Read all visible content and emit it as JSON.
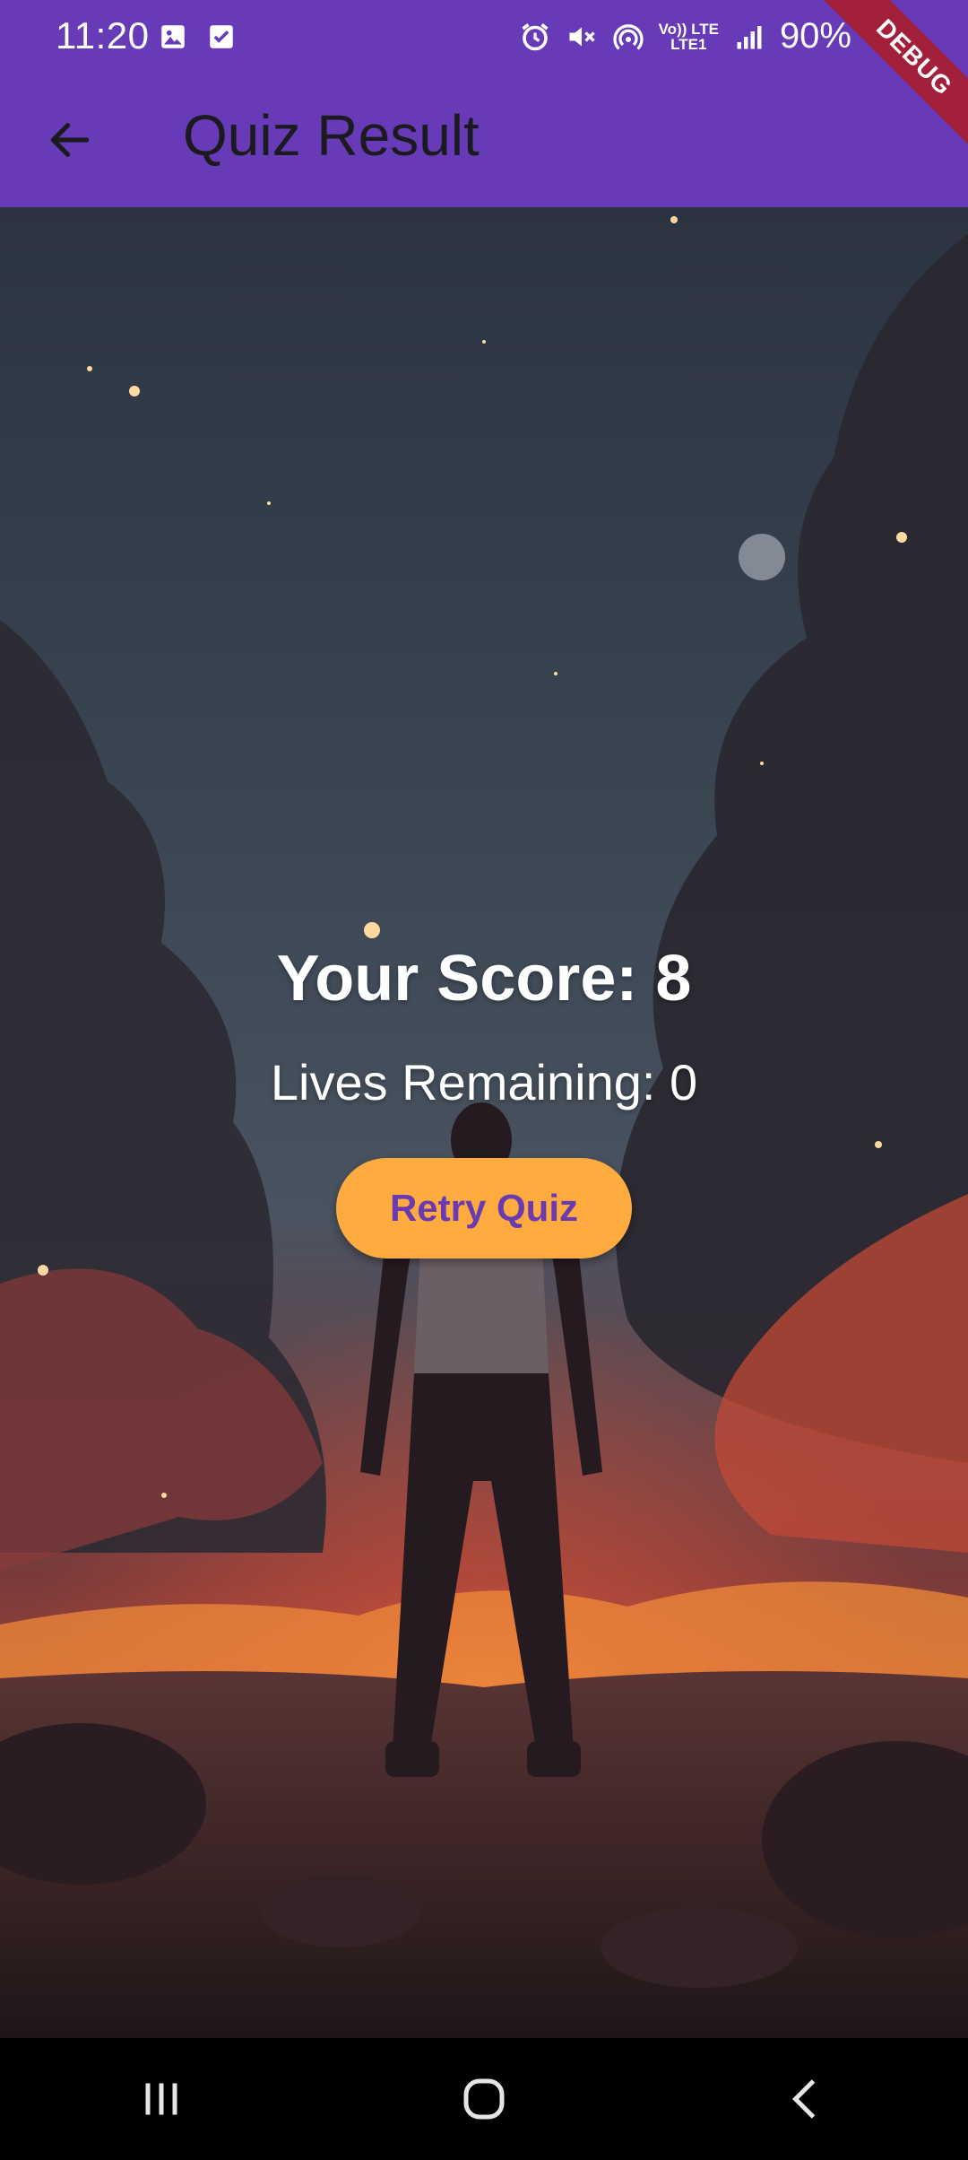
{
  "status_bar": {
    "time": "11:20",
    "lte_top": "Vo)) LTE",
    "lte_bottom": "LTE1",
    "battery": "90%",
    "left_icons": [
      "image-icon",
      "calendar-check-icon"
    ],
    "right_icons": [
      "alarm-icon",
      "mute-icon",
      "hotspot-icon",
      "lte-icon",
      "signal-icon",
      "battery-icon"
    ]
  },
  "debug_banner": "DEBUG",
  "app_bar": {
    "title": "Quiz Result",
    "back_icon": "arrow-back-icon",
    "background_color": "#673ab7"
  },
  "result": {
    "score_text": "Your Score: 8",
    "lives_text": "Lives Remaining: 0",
    "retry_label": "Retry Quiz",
    "retry_color": "#ffab40"
  },
  "nav_bar": {
    "buttons": [
      "recents-icon",
      "home-icon",
      "back-icon"
    ]
  }
}
